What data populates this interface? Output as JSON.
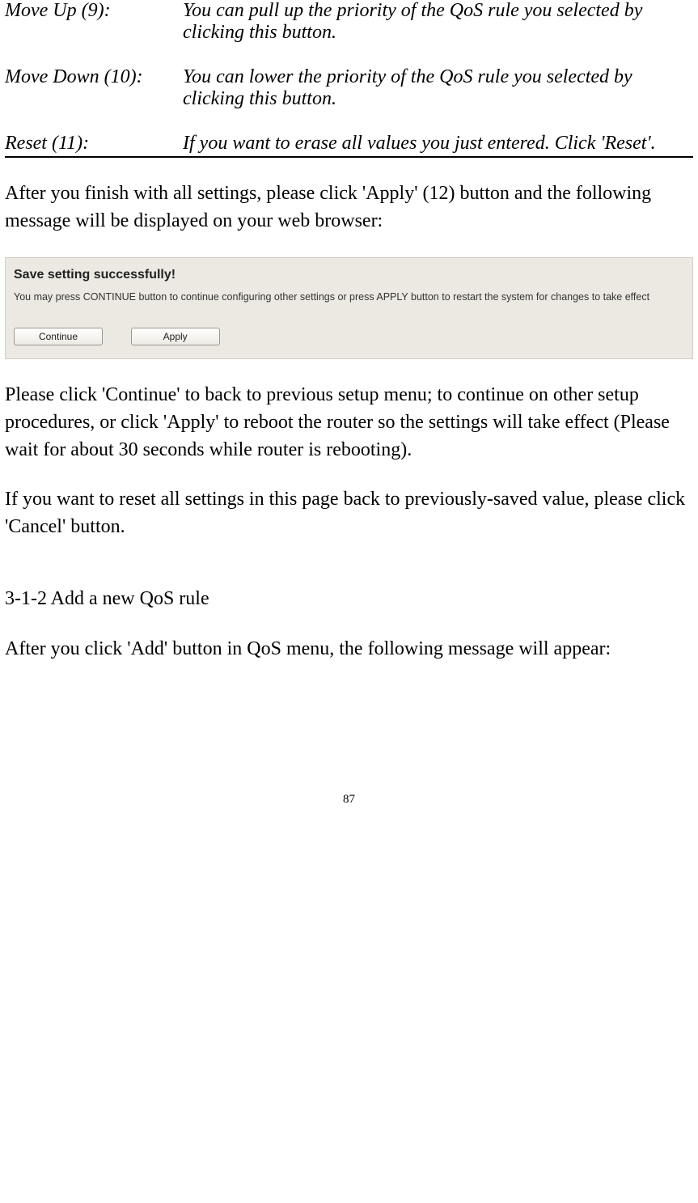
{
  "definitions": [
    {
      "term": "Move Up (9):",
      "desc": "You can pull up the priority of the QoS rule you selected by clicking this button."
    },
    {
      "term": "Move Down (10):",
      "desc": "You can lower the priority of the QoS rule you selected by clicking this button."
    },
    {
      "term": "Reset (11):",
      "desc": "If you want to erase all values you just entered. Click 'Reset'."
    }
  ],
  "para_after_defs": "After you finish with all settings, please click 'Apply' (12) button and the following message will be displayed on your web browser:",
  "confirm_box": {
    "title": "Save setting successfully!",
    "msg": "You may press CONTINUE button to continue configuring other settings or press APPLY button to restart the system for changes to take effect",
    "continue_label": "Continue",
    "apply_label": "Apply"
  },
  "para_continue": "Please click 'Continue' to back to previous setup menu; to continue on other setup procedures, or click 'Apply' to reboot the router so the settings will take effect (Please wait for about 30 seconds while router is rebooting).",
  "para_cancel": "If you want to reset all settings in this page back to previously-saved value, please click 'Cancel' button.",
  "section_heading": "3-1-2 Add a new QoS rule",
  "para_add": "After you click 'Add' button in QoS menu, the following message will appear:",
  "page_number": "87"
}
